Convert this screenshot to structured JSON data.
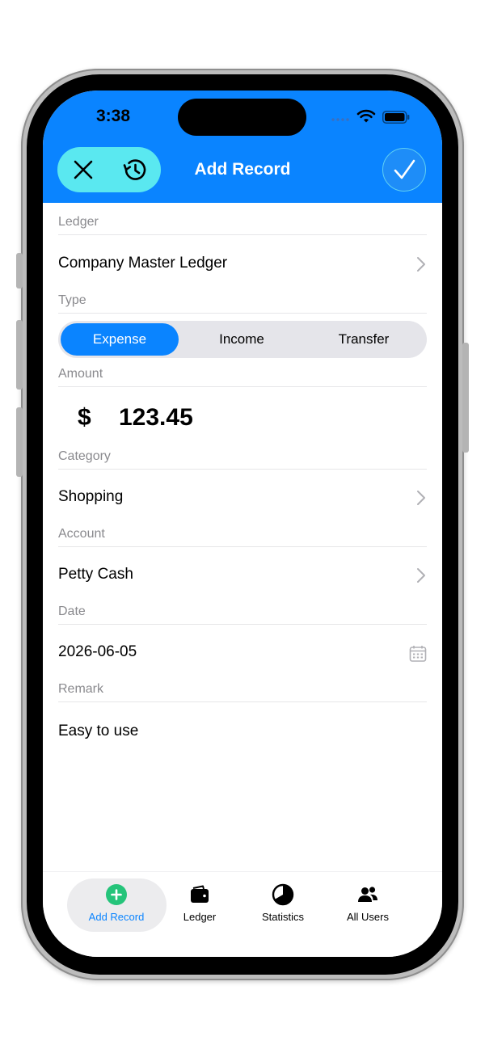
{
  "status_bar": {
    "time": "3:38"
  },
  "header": {
    "title": "Add Record"
  },
  "form": {
    "ledger": {
      "label": "Ledger",
      "value": "Company Master Ledger"
    },
    "type": {
      "label": "Type",
      "options": [
        "Expense",
        "Income",
        "Transfer"
      ],
      "selected": "Expense"
    },
    "amount": {
      "label": "Amount",
      "currency_symbol": "$",
      "value": "123.45"
    },
    "category": {
      "label": "Category",
      "value": "Shopping"
    },
    "account": {
      "label": "Account",
      "value": "Petty Cash"
    },
    "date": {
      "label": "Date",
      "value": "2026-06-05"
    },
    "remark": {
      "label": "Remark",
      "value": "Easy to use"
    }
  },
  "tab_bar": {
    "items": [
      {
        "label": "Add Record",
        "icon": "plus-circle-icon",
        "active": true
      },
      {
        "label": "Ledger",
        "icon": "wallet-icon",
        "active": false
      },
      {
        "label": "Statistics",
        "icon": "pie-chart-icon",
        "active": false
      },
      {
        "label": "All Users",
        "icon": "users-icon",
        "active": false
      }
    ]
  },
  "colors": {
    "accent": "#0a84ff",
    "header_pill": "#5ae8f0",
    "add_icon": "#25c47a",
    "secondary_text": "#8a8a8e"
  }
}
